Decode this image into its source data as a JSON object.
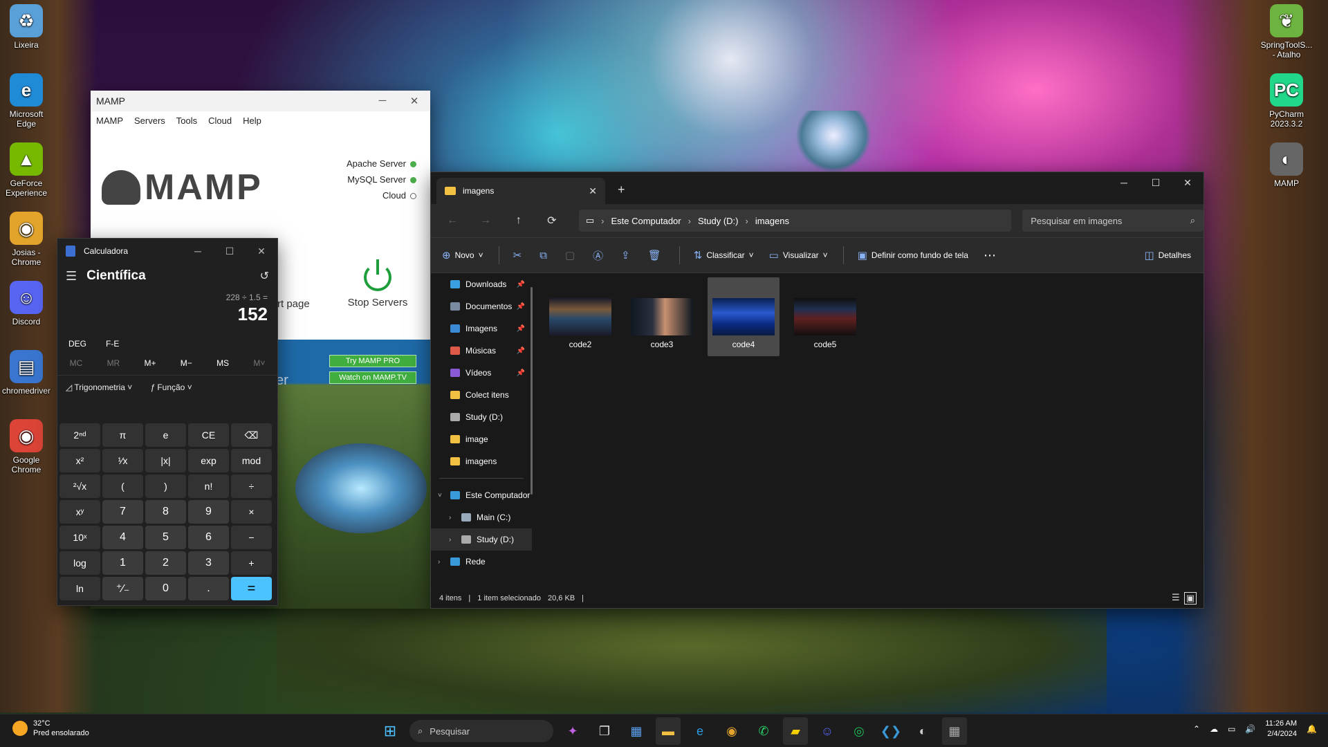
{
  "desktop": {
    "left_icons": [
      {
        "label": "Lixeira",
        "icon": "recycle-bin-icon",
        "glyph": "♻",
        "color": "#5aa0d8"
      },
      {
        "label": "Microsoft Edge",
        "icon": "edge-icon",
        "glyph": "e",
        "color": "#1f8ad6"
      },
      {
        "label": "GeForce Experience",
        "icon": "geforce-icon",
        "glyph": "▲",
        "color": "#76b900"
      },
      {
        "label": "Josias - Chrome",
        "icon": "chrome-profile-icon",
        "glyph": "◉",
        "color": "#e2a42b"
      },
      {
        "label": "Discord",
        "icon": "discord-icon",
        "glyph": "☺",
        "color": "#5865f2"
      },
      {
        "label": "chromedriver",
        "icon": "chromedriver-icon",
        "glyph": "▤",
        "color": "#3a76d0"
      },
      {
        "label": "Google Chrome",
        "icon": "chrome-icon",
        "glyph": "◉",
        "color": "#db4437"
      }
    ],
    "right_icons": [
      {
        "label": "SpringToolS... - Atalho",
        "icon": "spring-tools-icon",
        "glyph": "❦",
        "color": "#6db33f"
      },
      {
        "label": "PyCharm 2023.3.2",
        "icon": "pycharm-icon",
        "glyph": "PC",
        "color": "#21d789"
      },
      {
        "label": "MAMP",
        "icon": "mamp-icon",
        "glyph": "◐",
        "color": "#666666"
      }
    ]
  },
  "mamp": {
    "title": "MAMP",
    "menu": [
      "MAMP",
      "Servers",
      "Tools",
      "Cloud",
      "Help"
    ],
    "logo_text": "MAMP",
    "servers": [
      {
        "label": "Apache Server",
        "state": "on"
      },
      {
        "label": "MySQL Server",
        "state": "on"
      },
      {
        "label": "Cloud",
        "state": "off"
      }
    ],
    "start_page_partial": "rt page",
    "stop_label": "Stop Servers",
    "promo_buttons": [
      "Try MAMP PRO",
      "Watch on MAMP.TV"
    ],
    "partial_text": "er"
  },
  "calculator": {
    "title": "Calculadora",
    "mode": "Científica",
    "expression": "228 ÷ 1.5 =",
    "result": "152",
    "angle_mode": "DEG",
    "notation": "F-E",
    "memory": [
      "MC",
      "MR",
      "M+",
      "M−",
      "MS",
      "M˅"
    ],
    "function_menus": [
      "Trigonometria",
      "Função"
    ],
    "keys": [
      "2ⁿᵈ",
      "π",
      "e",
      "CE",
      "⌫",
      "x²",
      "¹⁄x",
      "|x|",
      "exp",
      "mod",
      "²√x",
      "(",
      ")",
      "n!",
      "÷",
      "xʸ",
      "7",
      "8",
      "9",
      "×",
      "10ˣ",
      "4",
      "5",
      "6",
      "−",
      "log",
      "1",
      "2",
      "3",
      "+",
      "ln",
      "⁺⁄₋",
      "0",
      ".",
      "="
    ]
  },
  "explorer": {
    "tab_title": "imagens",
    "breadcrumb": [
      "Este Computador",
      "Study (D:)",
      "imagens"
    ],
    "search_placeholder": "Pesquisar em imagens",
    "commands": {
      "new": "Novo",
      "sort": "Classificar",
      "view": "Visualizar",
      "set_wallpaper": "Definir como fundo de tela",
      "details": "Detalhes"
    },
    "sidebar": [
      {
        "label": "Downloads",
        "pinned": true,
        "color": "#3aa0e0"
      },
      {
        "label": "Documentos",
        "pinned": true,
        "color": "#7a8aa0"
      },
      {
        "label": "Imagens",
        "pinned": true,
        "color": "#3a8ad6"
      },
      {
        "label": "Músicas",
        "pinned": true,
        "color": "#e05a4a"
      },
      {
        "label": "Vídeos",
        "pinned": true,
        "color": "#8a5ad6"
      },
      {
        "label": "Colect itens",
        "pinned": false,
        "color": "#f2c144"
      },
      {
        "label": "Study (D:)",
        "pinned": false,
        "color": "#aaaaaa"
      },
      {
        "label": "image",
        "pinned": false,
        "color": "#f2c144"
      },
      {
        "label": "imagens",
        "pinned": false,
        "color": "#f2c144"
      }
    ],
    "tree": [
      {
        "label": "Este Computador",
        "expanded": true,
        "color": "#3a9ad9"
      },
      {
        "label": "Main (C:)",
        "expanded": false,
        "color": "#9ab"
      },
      {
        "label": "Study (D:)",
        "expanded": false,
        "color": "#aaa",
        "selected": true
      },
      {
        "label": "Rede",
        "expanded": false,
        "color": "#3a9ad9"
      }
    ],
    "files": [
      {
        "name": "code2",
        "selected": false
      },
      {
        "name": "code3",
        "selected": false
      },
      {
        "name": "code4",
        "selected": true
      },
      {
        "name": "code5",
        "selected": false
      }
    ],
    "status": {
      "count": "4 itens",
      "selection": "1 item selecionado",
      "size": "20,6 KB"
    }
  },
  "taskbar": {
    "weather_temp": "32°C",
    "weather_desc": "Pred ensolarado",
    "search_placeholder": "Pesquisar",
    "apps": [
      {
        "icon": "copilot-icon",
        "glyph": "✦",
        "color": "#c060e0"
      },
      {
        "icon": "task-view-icon",
        "glyph": "❐",
        "color": "#dddddd"
      },
      {
        "icon": "store-icon",
        "glyph": "▦",
        "color": "#5aa0f0"
      },
      {
        "icon": "file-explorer-icon",
        "glyph": "▬",
        "color": "#f2c144",
        "active": true
      },
      {
        "icon": "edge-icon",
        "glyph": "e",
        "color": "#2a9ae0"
      },
      {
        "icon": "chrome-icon",
        "glyph": "◉",
        "color": "#e2a42b"
      },
      {
        "icon": "whatsapp-icon",
        "glyph": "✆",
        "color": "#25d366"
      },
      {
        "icon": "sticky-notes-icon",
        "glyph": "▰",
        "color": "#f5d000",
        "active": true
      },
      {
        "icon": "discord-icon",
        "glyph": "☺",
        "color": "#5865f2"
      },
      {
        "icon": "spotify-icon",
        "glyph": "◎",
        "color": "#1db954"
      },
      {
        "icon": "vscode-icon",
        "glyph": "❮❯",
        "color": "#3a9ad9"
      },
      {
        "icon": "mamp-icon",
        "glyph": "◐",
        "color": "#cccccc"
      },
      {
        "icon": "calculator-icon",
        "glyph": "▦",
        "color": "#aaaaaa",
        "active": true
      }
    ],
    "time": "11:26 AM",
    "date": "2/4/2024"
  }
}
